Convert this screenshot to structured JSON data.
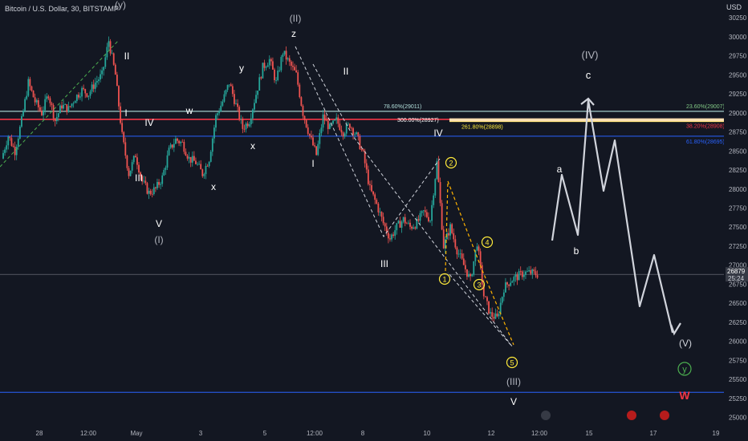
{
  "header": {
    "symbol_line": "Bitcoin / U.S. Dollar, 30, BITSTAMP"
  },
  "chart_data": {
    "type": "candlestick",
    "currency": "USD",
    "ylim": [
      24900,
      30400
    ],
    "y_ticks": [
      30250,
      30000,
      29750,
      29500,
      29250,
      29000,
      28750,
      28500,
      28250,
      28000,
      27750,
      27500,
      27250,
      27000,
      26750,
      26500,
      26250,
      26000,
      25750,
      25500,
      25250,
      25000
    ],
    "x_ticks": [
      "28",
      "12:00",
      "May",
      "3",
      "5",
      "12:00",
      "8",
      "10",
      "12",
      "12:00",
      "15",
      "17",
      "19"
    ],
    "last_price": "26879",
    "countdown": "25:24",
    "closes": [
      28400,
      28700,
      28500,
      28900,
      29400,
      29150,
      29000,
      29250,
      28900,
      29100,
      29050,
      29200,
      29300,
      29250,
      29400,
      29500,
      29950,
      29500,
      28700,
      28200,
      28450,
      28100,
      27950,
      28000,
      28150,
      28500,
      28650,
      28600,
      28400,
      28350,
      28200,
      28400,
      28950,
      29150,
      29400,
      29100,
      28800,
      28900,
      29250,
      29600,
      29700,
      29400,
      29800,
      29650,
      29500,
      29000,
      28700,
      28450,
      28950,
      28800,
      28900,
      28750,
      28850,
      28700,
      28450,
      28000,
      27800,
      27550,
      27350,
      27500,
      27600,
      27500,
      27550,
      27700,
      27600,
      28350,
      27250,
      27500,
      27200,
      27000,
      26800,
      27300,
      26600,
      26350,
      26300,
      26700,
      26800,
      26850,
      26900,
      26900,
      26879
    ],
    "horizontal_levels": [
      {
        "name": "78.60%(29011)",
        "value": 29011,
        "color": "#b2dfdb"
      },
      {
        "name": "23.60%(29007)",
        "value": 29007,
        "color": "#81c784"
      },
      {
        "name": "300.00%(28927)",
        "value": 28927,
        "color": "#f23645"
      },
      {
        "name": "261.80%(28898)",
        "value": 28898,
        "color": "#ffeb3b"
      },
      {
        "name": "38.20%(28908)",
        "value": 28908,
        "color": "#f23645"
      },
      {
        "name": "61.80%(28695)",
        "value": 28695,
        "color": "#2962ff"
      },
      {
        "name": "",
        "value": 26879,
        "color": "#787b86"
      },
      {
        "name": "",
        "value": 25330,
        "color": "#2962ff"
      }
    ],
    "wave_labels": [
      "(y)",
      "II",
      "I",
      "IV",
      "III",
      "V",
      "(I)",
      "w",
      "x",
      "y",
      "x",
      "(II)",
      "z",
      "II",
      "I",
      "IV",
      "III",
      "(III)",
      "V",
      "1",
      "2",
      "3",
      "4",
      "5",
      "(IV)",
      "c",
      "a",
      "b",
      "(V)",
      "y",
      "W"
    ]
  }
}
